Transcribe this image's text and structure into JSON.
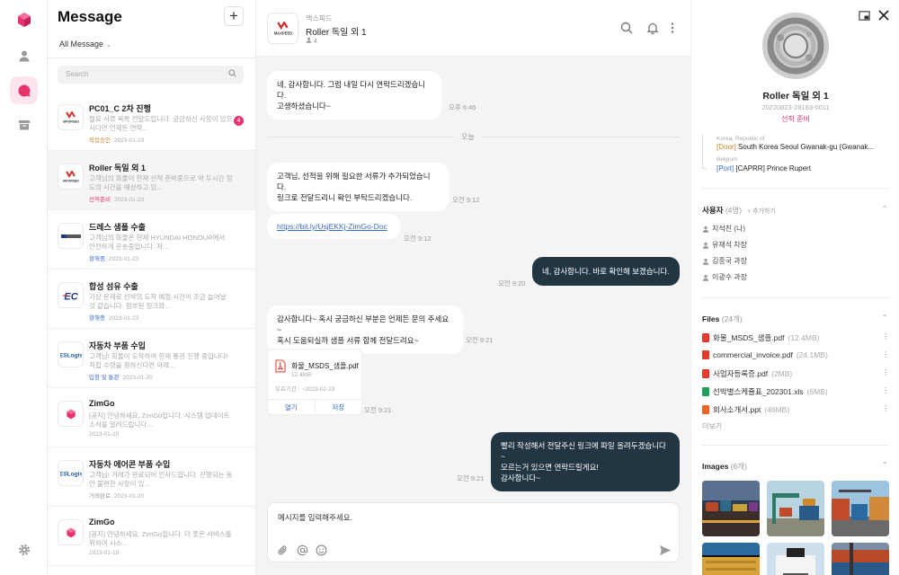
{
  "list": {
    "title": "Message",
    "filter_label": "All Message",
    "search_placeholder": "Search",
    "conversations": [
      {
        "title": "PC01_C 2차 진행",
        "preview": "필요 서류 목록 전달드립니다. 궁금하신 사항이 있으시다면 언제든 연락...",
        "tag": "작업승인",
        "date": "2023-01-23",
        "badge": "4"
      },
      {
        "title": "Roller 독일 외 1",
        "preview": "고객님의 화물이 현재 선적 준비중으로 약 두시간 정도의 시간을 예상하고 있...",
        "tag": "선적준비",
        "date": "2023-01-23"
      },
      {
        "title": "드레스 샘플 수출",
        "preview": "고객님의 화물은 현재 HYUNDAI HONOUR에서 안전하게 운송중입니다. 자...",
        "tag": "항해중",
        "date": "2023-01-23"
      },
      {
        "title": "합성 섬유 수출",
        "preview": "기상 문제로 선박의 도착 예정 시간이 조금 늘어날 것 같습니다. 첨부된 링크와...",
        "tag": "항해중",
        "date": "2023-01-23"
      },
      {
        "title": "자동차 부품 수입",
        "preview": "고객님! 화물이 도착하여 현재 통관 진행 중입니다! 직접 수령을 원하신다면 아래...",
        "tag": "입항 및 통관",
        "date": "2023-01-20"
      },
      {
        "title": "ZimGo",
        "preview": "[공지] 안녕하세요. ZimGo입니다. 시스템 업데이트 소식을 알려드립니다...",
        "tag": "",
        "date": "2023-01-20"
      },
      {
        "title": "자동차 에어콘 부품 수입",
        "preview": "고객님! 거래가 완료되어 인사드립니다. 진행되는 동안 불편한 사항이 있...",
        "tag": "거래완료",
        "date": "2023-01-20"
      },
      {
        "title": "ZimGo",
        "preview": "[공지] 안녕하세요. ZimGo입니다. 더 좋은 서비스를 위하여 시스...",
        "tag": "",
        "date": "2023-01-18"
      }
    ]
  },
  "chat": {
    "subtitle": "맥스피드",
    "title": "Roller 독일 외 1",
    "member_count": "4",
    "day_divider": "오늘",
    "messages": [
      {
        "text1": "네, 감사합니다. 그럼 내일 다시 연락드리겠습니다.",
        "text2": "고생하셨습니다~",
        "time": "오후 6:46"
      },
      {
        "text1": "고객님, 선적을 위해 필요한 서류가 추가되었습니다.",
        "text2": "링크로 전달드리니 확인 부탁드리겠습니다.",
        "time": "오전 9:12"
      },
      {
        "link": "https://bit.ly/UsjEKKj-ZimGo-Doc",
        "time": "오전 9:12"
      },
      {
        "text1": "네, 감사합니다. 바로 확인해 보겠습니다.",
        "time": "오전 9:20"
      },
      {
        "text1": "감사합니다~ 혹시 궁금하신 부분은 언제든 문의 주세요~",
        "text2": "혹시 도움되실까 샘플 서류 함께 전달드려요~",
        "time": "오전 9:21"
      },
      {
        "text1": "빨리 작성해서 전달주신 링크에 파일 올려두겠습니다~",
        "text2": "모르는거 있으면 연락드릴게요!",
        "text3": "감사합니다~",
        "time": "오전 9:21"
      }
    ],
    "file_card": {
      "name": "화물_MSDS_샘플.pdf",
      "size": "12.4MB",
      "expiry": "유효기간 : ~2023-02-23",
      "open": "열기",
      "save": "저장",
      "time": "오전 9:21"
    },
    "composer_placeholder": "메시지를 입력해주세요."
  },
  "panel": {
    "title": "Roller 독일 외 1",
    "id": "20220823-28163-0011",
    "status": "선적 준비",
    "origin_country": "Korea, Republic of",
    "origin_tag": "[Door]",
    "origin_addr": "South Korea Seoul Gwanak-gu (Gwanak...",
    "dest_country": "Belgium",
    "dest_tag": "[Port]",
    "dest_addr": "[CAPRR] Prince Rupert",
    "users_label": "사용자",
    "users_count": "(4명)",
    "users_add": "+ 추가하기",
    "users": [
      "지석진 (나)",
      "유재석 차장",
      "김종국 과장",
      "이광수 과장"
    ],
    "files_label": "Files",
    "files_count": "(24개)",
    "files": [
      {
        "name": "화물_MSDS_샘플.pdf",
        "size": "(12.4MB)",
        "color": "#e2392b"
      },
      {
        "name": "commercial_invoice.pdf",
        "size": "(24.1MB)",
        "color": "#e2392b"
      },
      {
        "name": "사업자등록증.pdf",
        "size": "(2MB)",
        "color": "#e2392b"
      },
      {
        "name": "선박별스케쥴표_202301.xls",
        "size": "(6MB)",
        "color": "#21a05a"
      },
      {
        "name": "회사소개서.ppt",
        "size": "(46MB)",
        "color": "#f0612a"
      }
    ],
    "more": "더보기",
    "images_label": "Images",
    "images_count": "(6개)"
  },
  "colors": {
    "accent": "#e8326c",
    "dark_bubble": "#223543",
    "link": "#3c6ec8"
  }
}
